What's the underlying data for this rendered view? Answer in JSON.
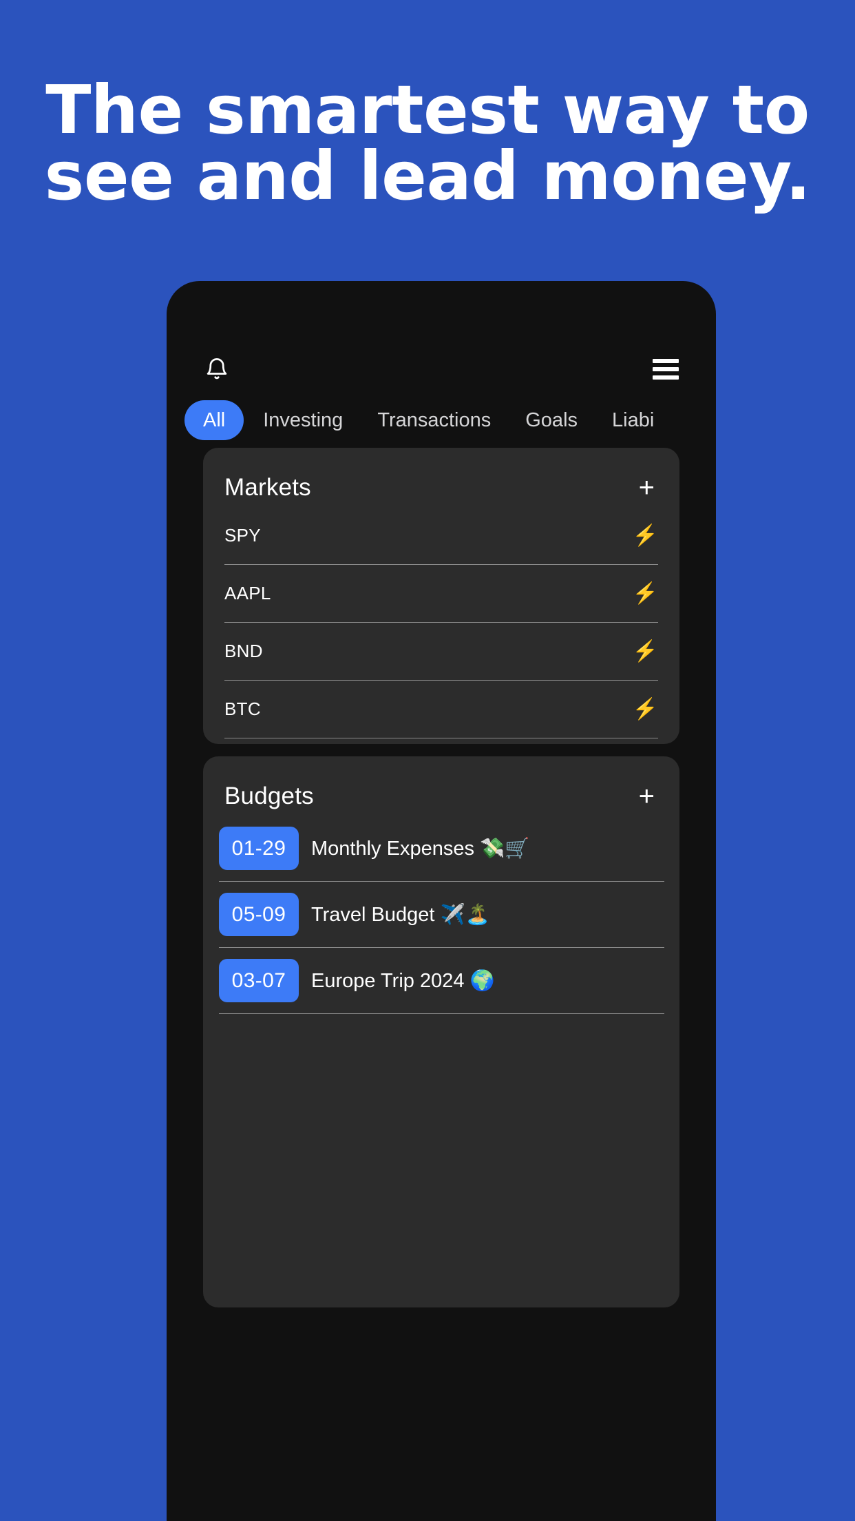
{
  "theme": {
    "background_blue": "#2b53bd",
    "accent_blue": "#3d7bf7",
    "phone_background": "#111111",
    "card_background": "#2c2c2c",
    "text_primary": "#ffffff",
    "text_muted": "#d5d5d7",
    "divider": "#8d8d8d",
    "bolt_gold": "#e8c35f"
  },
  "hero": {
    "line1": "The smartest way to",
    "line2": "see and lead money."
  },
  "phone": {
    "header": {
      "notifications_icon": "bell-icon",
      "menu_icon": "hamburger-menu-icon"
    },
    "tabs": [
      {
        "label": "All",
        "active": true
      },
      {
        "label": "Investing",
        "active": false
      },
      {
        "label": "Transactions",
        "active": false
      },
      {
        "label": "Goals",
        "active": false
      },
      {
        "label": "Liabi",
        "active": false
      }
    ],
    "markets_card": {
      "title": "Markets",
      "add_label": "+",
      "rows": [
        {
          "symbol": "SPY",
          "icon": "⚡"
        },
        {
          "symbol": "AAPL",
          "icon": "⚡"
        },
        {
          "symbol": "BND",
          "icon": "⚡"
        },
        {
          "symbol": "BTC",
          "icon": "⚡"
        }
      ]
    },
    "budgets_card": {
      "title": "Budgets",
      "add_label": "+",
      "rows": [
        {
          "date": "01-29",
          "label": "Monthly Expenses 💸🛒"
        },
        {
          "date": "05-09",
          "label": "Travel Budget ✈️🏝️"
        },
        {
          "date": "03-07",
          "label": "Europe Trip 2024 🌍"
        }
      ]
    }
  }
}
